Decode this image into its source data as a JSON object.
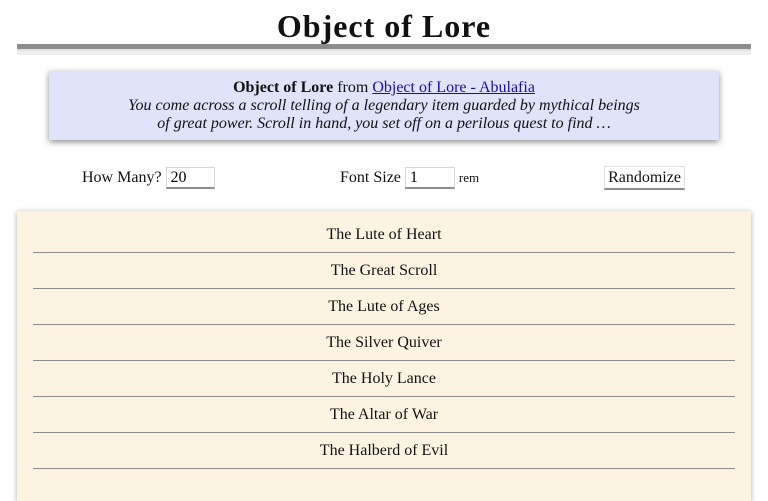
{
  "page": {
    "title": "Object of Lore"
  },
  "info": {
    "name": "Object of Lore",
    "from_text": "from",
    "link_text": "Object of Lore - Abulafia",
    "description": "You come across a scroll telling of a legendary item guarded by mythical beings of great power. Scroll in hand, you set off on a perilous quest to find …"
  },
  "controls": {
    "how_many_label": "How Many?",
    "how_many_value": "20",
    "font_size_label": "Font Size",
    "font_size_value": "1",
    "font_size_unit": "rem",
    "randomize_label": "Randomize"
  },
  "results": [
    "The Lute of Heart",
    "The Great Scroll",
    "The Lute of Ages",
    "The Silver Quiver",
    "The Holy Lance",
    "The Altar of War",
    "The Halberd of Evil"
  ]
}
